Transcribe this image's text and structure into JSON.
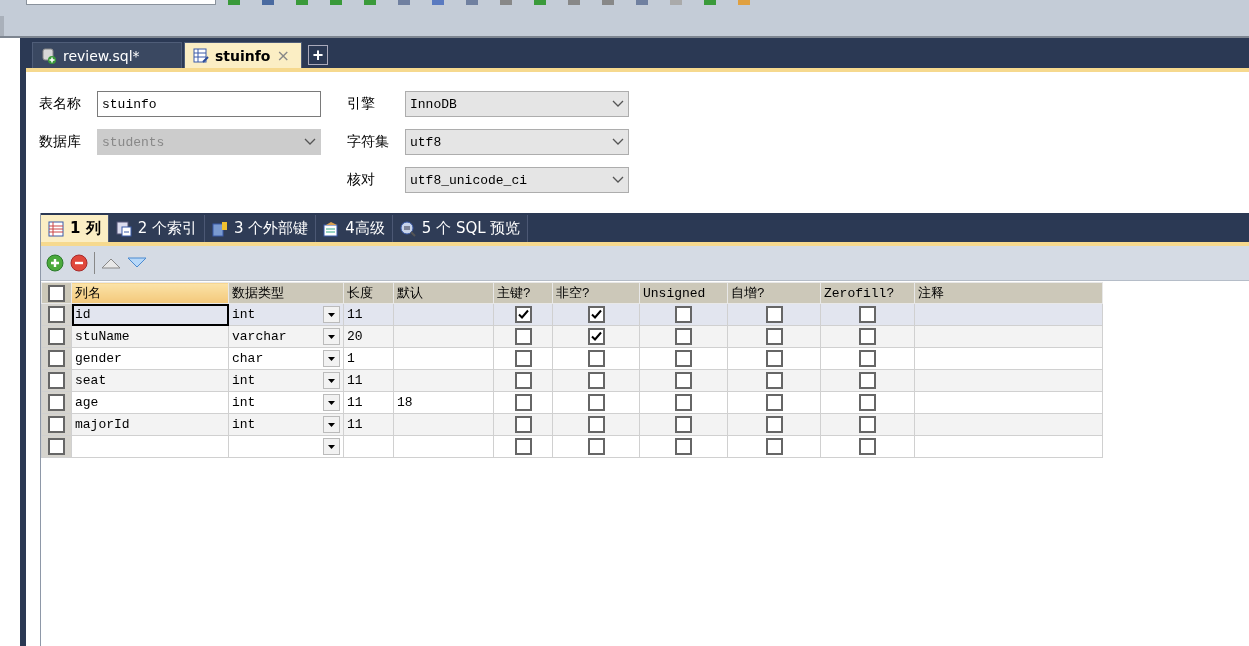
{
  "doc_tabs": [
    {
      "label": "review.sql*",
      "selected": false
    },
    {
      "label": "stuinfo",
      "selected": true
    }
  ],
  "doc_tab_close": "×",
  "new_tab": "+",
  "form": {
    "table_name": {
      "label": "表名称",
      "value": "stuinfo"
    },
    "database": {
      "label": "数据库",
      "value": "students",
      "disabled": true
    },
    "engine": {
      "label": "引擎",
      "value": "InnoDB"
    },
    "charset": {
      "label": "字符集",
      "value": "utf8"
    },
    "collation": {
      "label": "核对",
      "value": "utf8_unicode_ci"
    }
  },
  "inner_tabs": [
    {
      "label": "1 列",
      "selected": true
    },
    {
      "label": "2 个索引",
      "selected": false
    },
    {
      "label": "3 个外部键",
      "selected": false
    },
    {
      "label": "4高级",
      "selected": false
    },
    {
      "label": "5 个 SQL 预览",
      "selected": false
    }
  ],
  "grid": {
    "header_checked": false,
    "columns": [
      {
        "label": "列名",
        "selected": true
      },
      {
        "label": "数据类型",
        "selected": false
      },
      {
        "label": "长度",
        "selected": false
      },
      {
        "label": "默认",
        "selected": false
      },
      {
        "label": "主键?",
        "selected": false
      },
      {
        "label": "非空?",
        "selected": false
      },
      {
        "label": "Unsigned",
        "selected": false
      },
      {
        "label": "自增?",
        "selected": false
      },
      {
        "label": "Zerofill?",
        "selected": false
      },
      {
        "label": "注释",
        "selected": false
      }
    ],
    "rows": [
      {
        "selected": true,
        "checked": false,
        "name": "id",
        "type": "int",
        "length": "11",
        "primary_key": true,
        "not_null": true,
        "unsigned": false,
        "auto_increment": false,
        "zerofill": false
      },
      {
        "selected": false,
        "checked": false,
        "name": "stuName",
        "type": "varchar",
        "length": "20",
        "primary_key": false,
        "not_null": true,
        "unsigned": false,
        "auto_increment": false,
        "zerofill": false
      },
      {
        "selected": false,
        "checked": false,
        "name": "gender",
        "type": "char",
        "length": "1",
        "primary_key": false,
        "not_null": false,
        "unsigned": false,
        "auto_increment": false,
        "zerofill": false
      },
      {
        "selected": false,
        "checked": false,
        "name": "seat",
        "type": "int",
        "length": "11",
        "primary_key": false,
        "not_null": false,
        "unsigned": false,
        "auto_increment": false,
        "zerofill": false
      },
      {
        "selected": false,
        "checked": false,
        "name": "age",
        "type": "int",
        "length": "11",
        "default": "18",
        "primary_key": false,
        "not_null": false,
        "unsigned": false,
        "auto_increment": false,
        "zerofill": false
      },
      {
        "selected": false,
        "checked": false,
        "name": "majorId",
        "type": "int",
        "length": "11",
        "primary_key": false,
        "not_null": false,
        "unsigned": false,
        "auto_increment": false,
        "zerofill": false
      },
      {
        "selected": false,
        "checked": false,
        "primary_key": false,
        "not_null": false,
        "unsigned": false,
        "auto_increment": false,
        "zerofill": false
      }
    ]
  }
}
